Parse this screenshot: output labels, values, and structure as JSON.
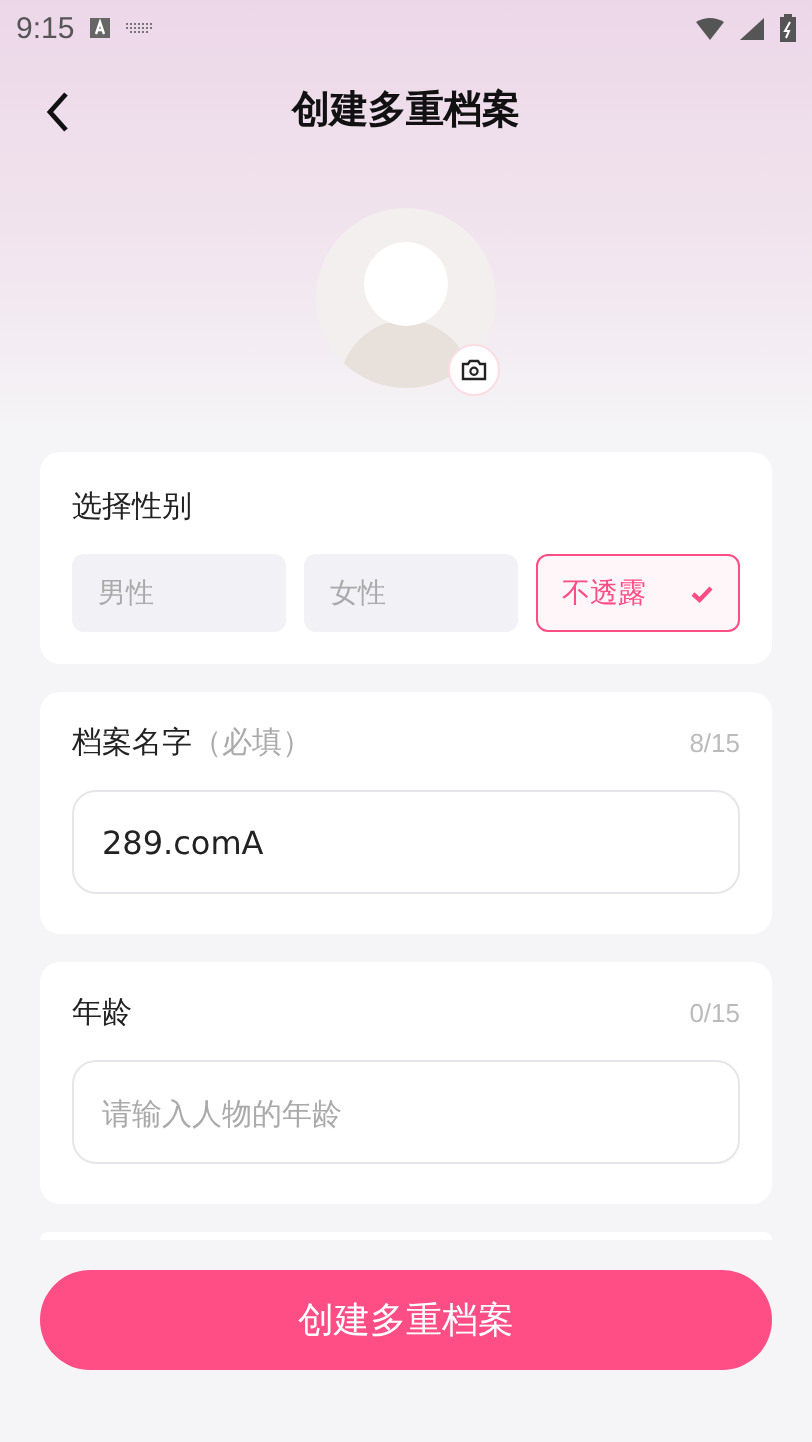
{
  "status_bar": {
    "time": "9:15"
  },
  "header": {
    "title": "创建多重档案"
  },
  "gender": {
    "label": "选择性别",
    "options": [
      {
        "label": "男性",
        "selected": false
      },
      {
        "label": "女性",
        "selected": false
      },
      {
        "label": "不透露",
        "selected": true
      }
    ]
  },
  "fields": [
    {
      "label": "档案名字",
      "note": "（必填）",
      "counter": "8/15",
      "value": "289.comA"
    },
    {
      "label": "年龄",
      "counter": "0/15",
      "placeholder": "请输入人物的年龄"
    }
  ],
  "submit_button": {
    "label": "创建多重档案"
  }
}
